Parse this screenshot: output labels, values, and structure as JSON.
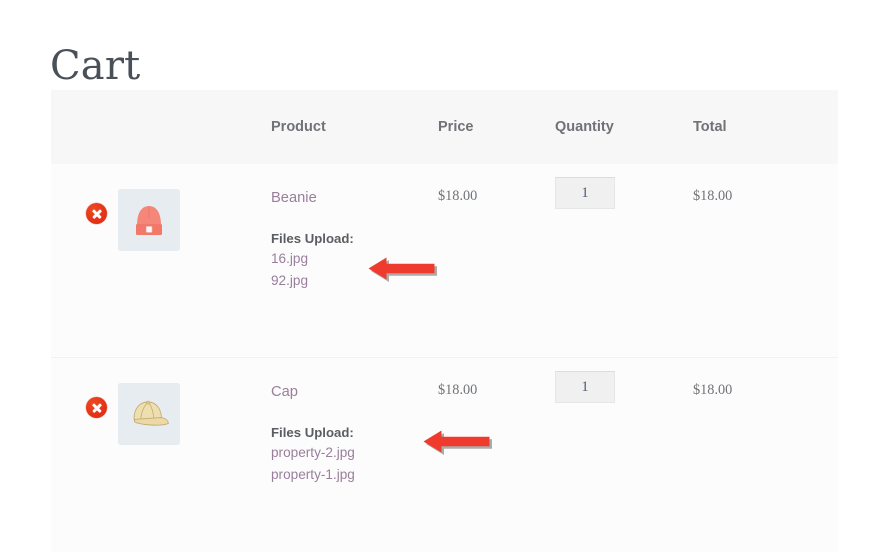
{
  "page": {
    "title": "Cart"
  },
  "table": {
    "headers": {
      "remove": "",
      "thumbnail": "",
      "product": "Product",
      "price": "Price",
      "quantity": "Quantity",
      "total": "Total"
    },
    "rows": [
      {
        "remove_icon": "remove-circle-x-icon",
        "thumbnail_icon": "beanie-hat-thumbnail",
        "product_name": "Beanie",
        "files_label": "Files Upload:",
        "files": [
          "16.jpg",
          "92.jpg"
        ],
        "price": "$18.00",
        "quantity": "1",
        "total": "$18.00"
      },
      {
        "remove_icon": "remove-circle-x-icon",
        "thumbnail_icon": "baseball-cap-thumbnail",
        "product_name": "Cap",
        "files_label": "Files Upload:",
        "files": [
          "property-2.jpg",
          "property-1.jpg"
        ],
        "price": "$18.00",
        "quantity": "1",
        "total": "$18.00"
      }
    ]
  },
  "annotations": [
    {
      "name": "arrow-pointing-to-beanie-files",
      "direction": "left"
    },
    {
      "name": "arrow-pointing-to-cap-files",
      "direction": "left"
    }
  ],
  "colors": {
    "accent_red": "#ef3b2d",
    "link_purple": "#9a7e9c",
    "header_bg": "#f7f7f7",
    "row_bg": "#fcfcfc",
    "thumb_bg": "#e7ecf0",
    "text_gray": "#6f7276",
    "title_gray": "#4a5058"
  }
}
